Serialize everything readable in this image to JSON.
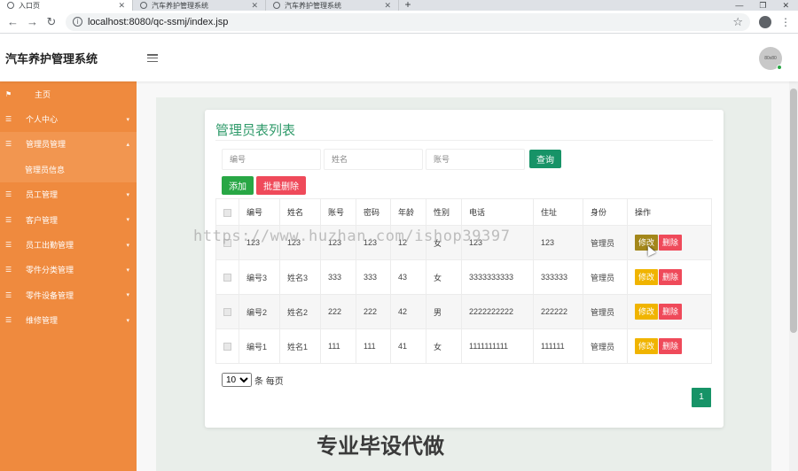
{
  "browser": {
    "tabs": [
      {
        "title": "入口页",
        "active": true
      },
      {
        "title": "汽车养护管理系统",
        "active": false
      },
      {
        "title": "汽车养护管理系统",
        "active": false
      }
    ],
    "url": "localhost:8080/qc-ssmj/index.jsp"
  },
  "header": {
    "title": "汽车养护管理系统",
    "avatar_text": "80x80"
  },
  "sidebar": {
    "items": [
      {
        "label": "主页",
        "icon": "flag-icon",
        "expandable": false
      },
      {
        "label": "个人中心",
        "icon": "list-icon",
        "expandable": true
      },
      {
        "label": "管理员管理",
        "icon": "list-icon",
        "expandable": true,
        "open": true
      },
      {
        "label": "管理员信息",
        "sub": true
      },
      {
        "label": "员工管理",
        "icon": "list-icon",
        "expandable": true
      },
      {
        "label": "客户管理",
        "icon": "list-icon",
        "expandable": true
      },
      {
        "label": "员工出勤管理",
        "icon": "list-icon",
        "expandable": true
      },
      {
        "label": "零件分类管理",
        "icon": "list-icon",
        "expandable": true
      },
      {
        "label": "零件设备管理",
        "icon": "list-icon",
        "expandable": true
      },
      {
        "label": "维修管理",
        "icon": "list-icon",
        "expandable": true
      }
    ]
  },
  "page": {
    "title": "管理员表列表",
    "search": {
      "number_placeholder": "编号",
      "name_placeholder": "姓名",
      "account_placeholder": "账号",
      "query_label": "查询"
    },
    "add_label": "添加",
    "batch_delete_label": "批量删除",
    "table": {
      "columns": [
        "编号",
        "姓名",
        "账号",
        "密码",
        "年龄",
        "性别",
        "电话",
        "住址",
        "身份",
        "操作"
      ],
      "rows": [
        {
          "number": "123",
          "name": "123",
          "account": "123",
          "password": "123",
          "age": "12",
          "gender": "女",
          "phone": "123",
          "address": "123",
          "role": "管理员"
        },
        {
          "number": "编号3",
          "name": "姓名3",
          "account": "333",
          "password": "333",
          "age": "43",
          "gender": "女",
          "phone": "3333333333",
          "address": "333333",
          "role": "管理员"
        },
        {
          "number": "编号2",
          "name": "姓名2",
          "account": "222",
          "password": "222",
          "age": "42",
          "gender": "男",
          "phone": "2222222222",
          "address": "222222",
          "role": "管理员"
        },
        {
          "number": "编号1",
          "name": "姓名1",
          "account": "111",
          "password": "111",
          "age": "41",
          "gender": "女",
          "phone": "1111111111",
          "address": "111111",
          "role": "管理员"
        }
      ],
      "edit_label": "修改",
      "delete_label": "删除"
    },
    "pager": {
      "page_size": "10",
      "per_page_suffix": "条 每页",
      "current_page": "1"
    }
  },
  "watermark": "https://www.huzhan.com/ishop39397",
  "overlay_caption": "专业毕设代做",
  "colors": {
    "sidebar": "#ef8a3e",
    "accent_green": "#179367",
    "danger": "#ef4a5a",
    "warning": "#f0b400"
  }
}
